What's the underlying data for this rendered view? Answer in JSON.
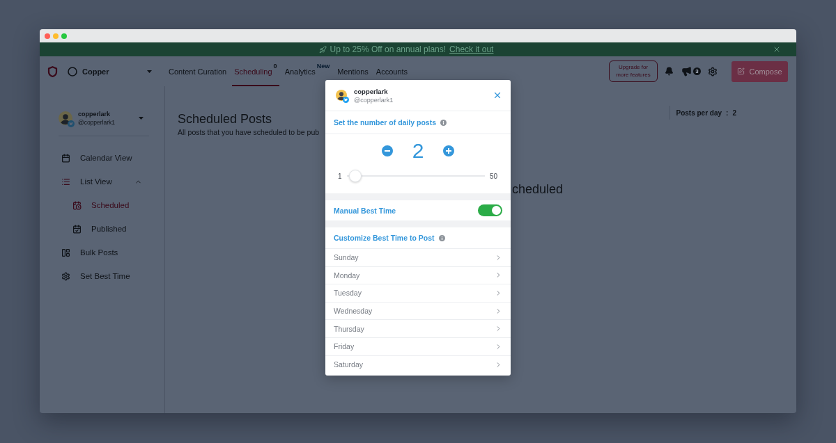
{
  "banner": {
    "text": "Up to 25% Off on annual plans!",
    "link": "Check it out"
  },
  "navbar": {
    "workspace": "Copper",
    "tabs": [
      {
        "label": "Content Curation",
        "selected": false
      },
      {
        "label": "Scheduling",
        "selected": true,
        "badge": "0"
      },
      {
        "label": "Analytics",
        "selected": false,
        "tag": "New"
      },
      {
        "label": "Mentions",
        "selected": false
      },
      {
        "label": "Accounts",
        "selected": false
      }
    ],
    "upgrade_button": "Upgrade for more features",
    "announcements_badge": "3",
    "compose_button": "Compose"
  },
  "sidebar": {
    "account": {
      "name": "copperlark",
      "handle": "@copperlark1"
    },
    "items": [
      {
        "label": "Calendar View",
        "selected": false
      },
      {
        "label": "List View",
        "selected": false,
        "expanded": true,
        "children": [
          {
            "label": "Scheduled",
            "selected": true
          },
          {
            "label": "Published",
            "selected": false
          }
        ]
      },
      {
        "label": "Bulk Posts",
        "selected": false
      },
      {
        "label": "Set Best Time",
        "selected": false
      }
    ]
  },
  "main": {
    "title": "Scheduled Posts",
    "subtitle": "All posts that you have scheduled to be pub",
    "posts_per_day": {
      "label": "Posts per day",
      "separator": ":",
      "value": "2"
    },
    "empty_message": "cheduled"
  },
  "modal": {
    "account": {
      "name": "copperlark",
      "handle": "@copperlark1"
    },
    "daily_posts": {
      "title": "Set the number of daily posts",
      "value": "2",
      "min": "1",
      "max": "50",
      "level": 0.02
    },
    "manual_best_time": {
      "label": "Manual Best Time",
      "on": true
    },
    "customize": {
      "title": "Customize Best Time to Post",
      "days": [
        {
          "label": "Sunday",
          "expanded": false
        },
        {
          "label": "Monday",
          "expanded": false
        },
        {
          "label": "Tuesday",
          "expanded": false
        },
        {
          "label": "Wednesday",
          "expanded": false
        },
        {
          "label": "Thursday",
          "expanded": false
        },
        {
          "label": "Friday",
          "expanded": false
        },
        {
          "label": "Saturday",
          "expanded": false
        }
      ]
    }
  }
}
